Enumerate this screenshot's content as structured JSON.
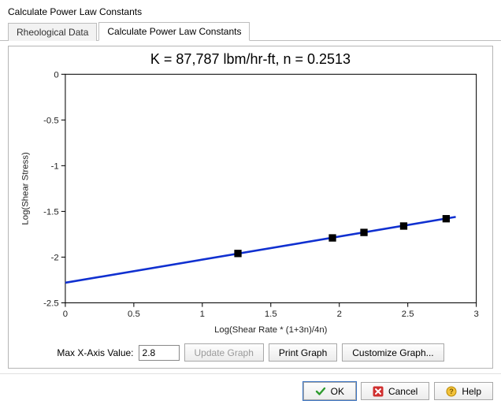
{
  "window": {
    "title": "Calculate Power Law Constants"
  },
  "tabs": [
    {
      "label": "Rheological Data",
      "active": false
    },
    {
      "label": "Calculate Power Law Constants",
      "active": true
    }
  ],
  "controls": {
    "max_x_label": "Max X-Axis Value:",
    "max_x_value": "2.8",
    "update_label": "Update Graph",
    "print_label": "Print Graph",
    "customize_label": "Customize Graph..."
  },
  "footer": {
    "ok_label": "OK",
    "cancel_label": "Cancel",
    "help_label": "Help"
  },
  "chart_data": {
    "type": "scatter",
    "title": "K = 87,787 lbm/hr-ft, n = 0.2513",
    "xlabel": "Log(Shear Rate * (1+3n)/4n)",
    "ylabel": "Log(Shear Stress)",
    "xlim": [
      0,
      3
    ],
    "ylim": [
      -2.5,
      0
    ],
    "xticks": [
      0,
      0.5,
      1,
      1.5,
      2,
      2.5,
      3
    ],
    "yticks": [
      -2.5,
      -2,
      -1.5,
      -1,
      -0.5,
      0
    ],
    "points": [
      {
        "x": 1.26,
        "y": -1.96
      },
      {
        "x": 1.95,
        "y": -1.79
      },
      {
        "x": 2.18,
        "y": -1.73
      },
      {
        "x": 2.47,
        "y": -1.66
      },
      {
        "x": 2.78,
        "y": -1.58
      }
    ],
    "fit_line": {
      "x1": 0,
      "y1": -2.28,
      "x2": 2.85,
      "y2": -1.56
    }
  }
}
